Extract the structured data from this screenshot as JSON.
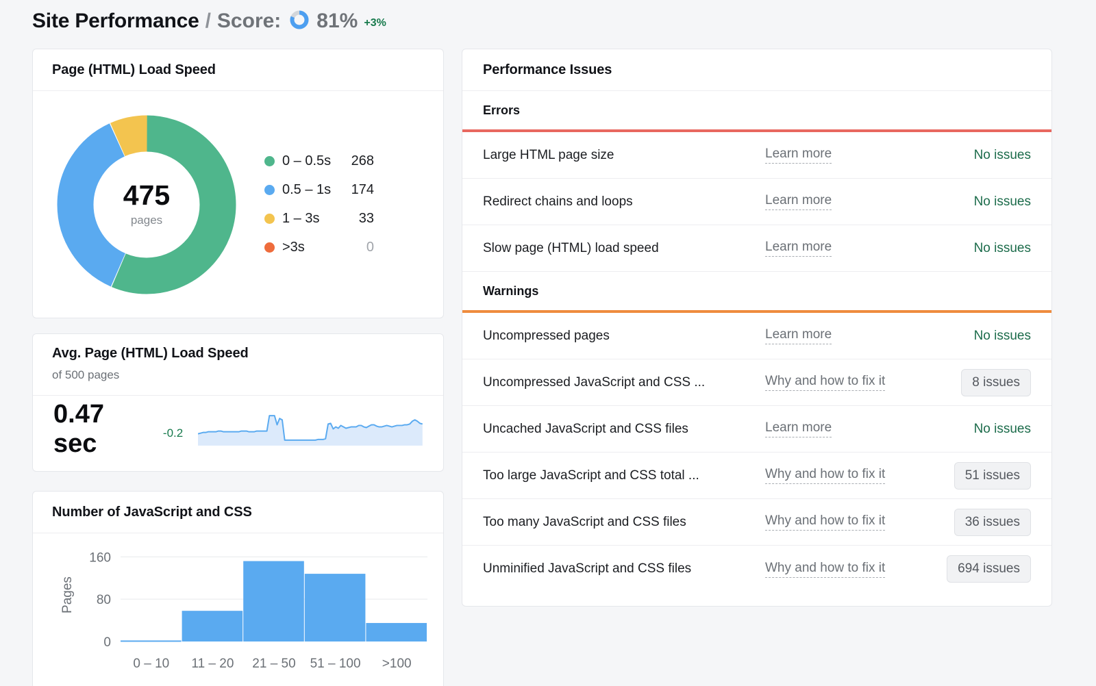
{
  "header": {
    "title": "Site Performance",
    "separator": "/",
    "score_label": "Score:",
    "score_value": "81%",
    "score_percent": 81,
    "delta": "+3%",
    "ring_icon": "score-ring-icon"
  },
  "colors": {
    "green": "#4fb68c",
    "blue": "#5aaaf0",
    "yellow": "#f4c košt",
    "yellow_hex": "#f3c44f",
    "orange": "#ee6c3c",
    "error_rule": "#e8685f",
    "warning_rule": "#ef8c3e",
    "positive_text": "#177a4c",
    "bar_blue": "#5aaaf0",
    "spark_fill": "#dceafb"
  },
  "load_speed_card": {
    "title": "Page (HTML) Load Speed",
    "total": "475",
    "unit": "pages",
    "legend": [
      {
        "label": "0 – 0.5s",
        "value": "268",
        "color": "#4fb68c",
        "zero": false
      },
      {
        "label": "0.5 – 1s",
        "value": "174",
        "color": "#5aaaf0",
        "zero": false
      },
      {
        "label": "1 – 3s",
        "value": "33",
        "color": "#f3c44f",
        "zero": false
      },
      {
        "label": ">3s",
        "value": "0",
        "color": "#ee6c3c",
        "zero": true
      }
    ]
  },
  "avg_speed_card": {
    "title": "Avg. Page (HTML) Load Speed",
    "subtitle": "of 500 pages",
    "value": "0.47 sec",
    "delta": "-0.2"
  },
  "bars_card": {
    "title": "Number of JavaScript and CSS"
  },
  "issues_panel": {
    "title": "Performance Issues",
    "groups": [
      {
        "name": "Errors",
        "rule_class": "errors",
        "rows": [
          {
            "name": "Large HTML page size",
            "link": "Learn more",
            "status": "No issues",
            "is_badge": false
          },
          {
            "name": "Redirect chains and loops",
            "link": "Learn more",
            "status": "No issues",
            "is_badge": false
          },
          {
            "name": "Slow page (HTML) load speed",
            "link": "Learn more",
            "status": "No issues",
            "is_badge": false
          }
        ]
      },
      {
        "name": "Warnings",
        "rule_class": "warnings",
        "rows": [
          {
            "name": "Uncompressed pages",
            "link": "Learn more",
            "status": "No issues",
            "is_badge": false
          },
          {
            "name": "Uncompressed JavaScript and CSS ...",
            "link": "Why and how to fix it",
            "status": "8 issues",
            "is_badge": true
          },
          {
            "name": "Uncached JavaScript and CSS files",
            "link": "Learn more",
            "status": "No issues",
            "is_badge": false
          },
          {
            "name": "Too large JavaScript and CSS total ...",
            "link": "Why and how to fix it",
            "status": "51 issues",
            "is_badge": true
          },
          {
            "name": "Too many JavaScript and CSS files",
            "link": "Why and how to fix it",
            "status": "36 issues",
            "is_badge": true
          },
          {
            "name": "Unminified JavaScript and CSS files",
            "link": "Why and how to fix it",
            "status": "694 issues",
            "is_badge": true
          }
        ]
      }
    ]
  },
  "chart_data": [
    {
      "type": "pie",
      "title": "Page (HTML) Load Speed",
      "center_label": "475",
      "center_sublabel": "pages",
      "categories": [
        "0 – 0.5s",
        "0.5 – 1s",
        "1 – 3s",
        ">3s"
      ],
      "values": [
        268,
        174,
        33,
        0
      ],
      "colors": [
        "#4fb68c",
        "#5aaaf0",
        "#f3c44f",
        "#ee6c3c"
      ],
      "total": 475,
      "legend_position": "right",
      "donut": true
    },
    {
      "type": "line",
      "title": "Avg. Page (HTML) Load Speed",
      "subtitle": "of 500 pages",
      "current_value": 0.47,
      "value_label": "0.47 sec",
      "delta": -0.2,
      "delta_label": "-0.2",
      "xlabel": "",
      "ylabel": "",
      "grid": false,
      "area_fill": true,
      "y": [
        0.4,
        0.41,
        0.42,
        0.42,
        0.43,
        0.43,
        0.43,
        0.43,
        0.44,
        0.44,
        0.43,
        0.43,
        0.43,
        0.43,
        0.43,
        0.43,
        0.43,
        0.44,
        0.44,
        0.44,
        0.43,
        0.43,
        0.43,
        0.44,
        0.44,
        0.44,
        0.44,
        0.44,
        0.66,
        0.66,
        0.66,
        0.53,
        0.62,
        0.6,
        0.31,
        0.31,
        0.31,
        0.31,
        0.31,
        0.31,
        0.31,
        0.31,
        0.31,
        0.31,
        0.31,
        0.31,
        0.31,
        0.32,
        0.32,
        0.32,
        0.33,
        0.54,
        0.55,
        0.47,
        0.5,
        0.48,
        0.52,
        0.5,
        0.48,
        0.49,
        0.5,
        0.5,
        0.5,
        0.52,
        0.52,
        0.5,
        0.49,
        0.51,
        0.53,
        0.53,
        0.51,
        0.5,
        0.5,
        0.51,
        0.52,
        0.51,
        0.5,
        0.51,
        0.52,
        0.52,
        0.52,
        0.53,
        0.53,
        0.54,
        0.58,
        0.6,
        0.58,
        0.55,
        0.54
      ]
    },
    {
      "type": "bar",
      "title": "Number of JavaScript and CSS",
      "categories": [
        "0 – 10",
        "11 – 20",
        "21 – 50",
        "51 – 100",
        ">100"
      ],
      "values": [
        2,
        58,
        152,
        128,
        35
      ],
      "xlabel": "",
      "ylabel": "Pages",
      "ylim": [
        0,
        176
      ],
      "yticks": [
        0,
        80,
        160
      ],
      "ytick_labels": [
        "0",
        "80",
        "160"
      ],
      "grid": true,
      "bar_color": "#5aaaf0"
    }
  ]
}
